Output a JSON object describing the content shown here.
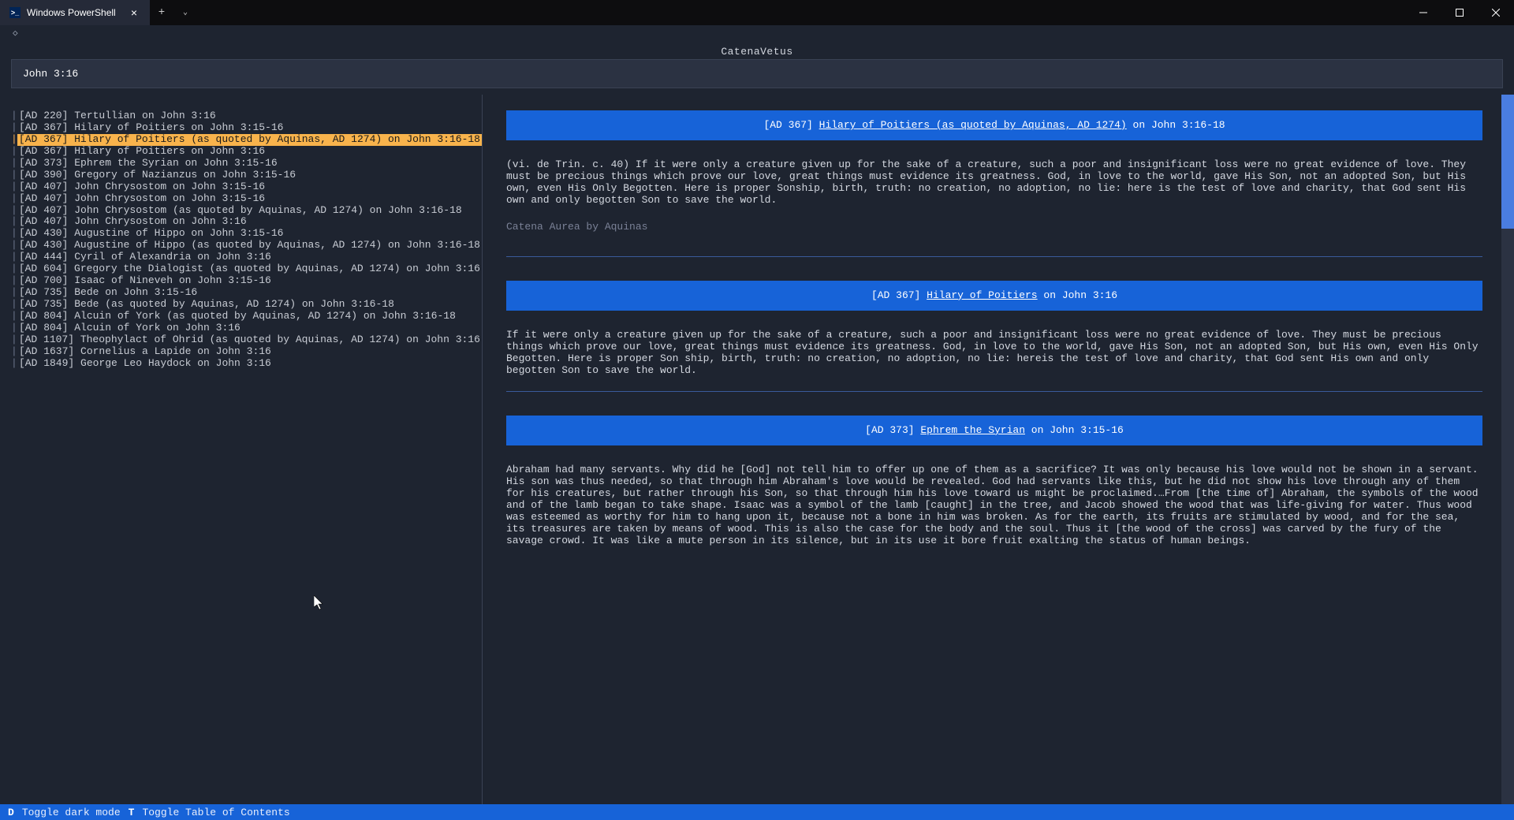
{
  "window": {
    "tab_title": "Windows PowerShell",
    "diamond": "◇"
  },
  "app": {
    "title": "CatenaVetus",
    "search_value": "John 3:16"
  },
  "toc": [
    {
      "t": "[AD 220] Tertullian on John 3:16",
      "sel": false
    },
    {
      "t": "[AD 367] Hilary of Poitiers on John 3:15-16",
      "sel": false
    },
    {
      "t": "[AD 367] Hilary of Poitiers (as quoted by Aquinas, AD 1274) on John 3:16-18",
      "sel": true
    },
    {
      "t": "[AD 367] Hilary of Poitiers on John 3:16",
      "sel": false
    },
    {
      "t": "[AD 373] Ephrem the Syrian on John 3:15-16",
      "sel": false
    },
    {
      "t": "[AD 390] Gregory of Nazianzus on John 3:15-16",
      "sel": false
    },
    {
      "t": "[AD 407] John Chrysostom on John 3:15-16",
      "sel": false
    },
    {
      "t": "[AD 407] John Chrysostom on John 3:15-16",
      "sel": false
    },
    {
      "t": "[AD 407] John Chrysostom (as quoted by Aquinas, AD 1274) on John 3:16-18",
      "sel": false
    },
    {
      "t": "[AD 407] John Chrysostom on John 3:16",
      "sel": false
    },
    {
      "t": "[AD 430] Augustine of Hippo on John 3:15-16",
      "sel": false
    },
    {
      "t": "[AD 430] Augustine of Hippo (as quoted by Aquinas, AD 1274) on John 3:16-18",
      "sel": false
    },
    {
      "t": "[AD 444] Cyril of Alexandria on John 3:16",
      "sel": false
    },
    {
      "t": "[AD 604] Gregory the Dialogist (as quoted by Aquinas, AD 1274) on John 3:16-18",
      "sel": false
    },
    {
      "t": "[AD 700] Isaac of Nineveh on John 3:15-16",
      "sel": false
    },
    {
      "t": "[AD 735] Bede on John 3:15-16",
      "sel": false
    },
    {
      "t": "[AD 735] Bede (as quoted by Aquinas, AD 1274) on John 3:16-18",
      "sel": false
    },
    {
      "t": "[AD 804] Alcuin of York (as quoted by Aquinas, AD 1274) on John 3:16-18",
      "sel": false
    },
    {
      "t": "[AD 804] Alcuin of York on John 3:16",
      "sel": false
    },
    {
      "t": "[AD 1107] Theophylact of Ohrid (as quoted by Aquinas, AD 1274) on John 3:16-18",
      "sel": false
    },
    {
      "t": "[AD 1637] Cornelius a Lapide on John 3:16",
      "sel": false
    },
    {
      "t": "[AD 1849] George Leo Haydock on John 3:16",
      "sel": false
    }
  ],
  "entries": [
    {
      "prefix": "[AD 367] ",
      "author": "Hilary of Poitiers (as quoted by Aquinas, AD 1274)",
      "suffix": " on John 3:16-18",
      "body": "(vi. de Trin. c. 40) If it were only a creature given up for the sake of a creature, such a poor and insignificant loss were no great evidence of love. They must be precious things which prove our love, great things must evidence its greatness. God, in love to the world, gave His Son, not an adopted Son, but His own, even His Only Begotten. Here is proper Sonship, birth, truth: no creation, no adoption, no lie: here is the test of love and charity, that God sent His own and only begotten Son to save the world.",
      "source": "Catena Aurea by Aquinas"
    },
    {
      "prefix": "[AD 367] ",
      "author": "Hilary of Poitiers",
      "suffix": " on John 3:16",
      "body": "If it were only a creature given up for the sake of a creature, such a poor and insignificant loss were no great evidence of love. They must be precious things which prove our love, great things must evidence its greatness. God, in love to the world, gave His Son, not an adopted Son, but His own, even His Only Begotten. Here is proper Son ship, birth, truth: no creation, no adoption, no lie: hereis the test of love and charity, that God sent His own and only begotten Son to save the world.",
      "source": ""
    },
    {
      "prefix": "[AD 373] ",
      "author": "Ephrem the Syrian",
      "suffix": " on John 3:15-16",
      "body": "Abraham had many servants. Why did he [God] not tell him to offer up one of them as a sacrifice? It was only because his love would not be shown in a servant. His son was thus needed, so that through him Abraham's love would be revealed. God had servants like this, but he did not show his love through any of them for his creatures, but rather through his Son, so that through him his love toward us might be proclaimed.…From [the time of] Abraham, the symbols of the wood and of the lamb began to take shape. Isaac was a symbol of the lamb [caught] in the tree, and Jacob showed the wood that was life-giving for water. Thus wood was esteemed as worthy for him to hang upon it, because not a bone in him was broken. As for the earth, its fruits are stimulated by wood, and for the sea, its treasures are taken by means of wood. This is also the case for the body and the soul. Thus it [the wood of the cross] was carved by the fury of the savage crowd. It was like a mute person in its silence, but in its use it bore fruit exalting the status of human beings.",
      "source": ""
    }
  ],
  "footer": {
    "k1": "D",
    "l1": "Toggle dark mode",
    "k2": "T",
    "l2": "Toggle Table of Contents"
  }
}
